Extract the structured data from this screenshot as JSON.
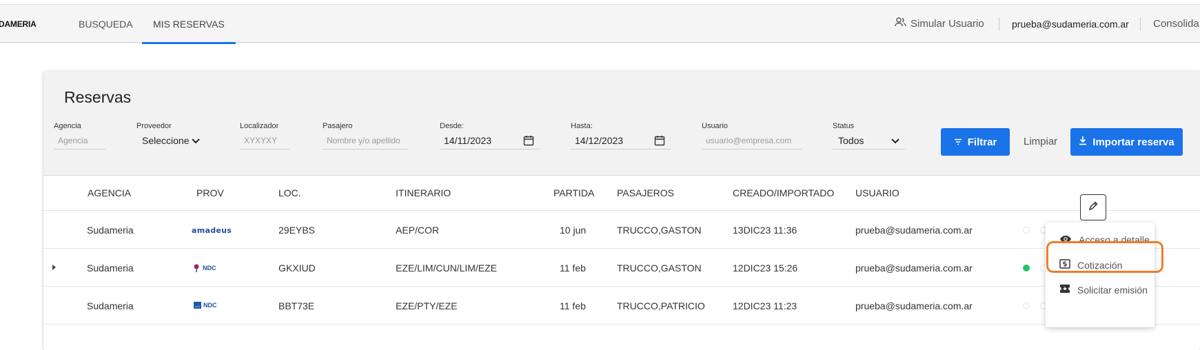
{
  "nav": {
    "brand": "DAMERIA",
    "tabs": [
      {
        "label": "BUSQUEDA"
      },
      {
        "label": "MIS RESERVAS"
      }
    ],
    "simulate_user": "Simular Usuario",
    "email": "prueba@sudameria.com.ar",
    "consolidate": "Consolida"
  },
  "page": {
    "title": "Reservas"
  },
  "filters": {
    "agencia": {
      "label": "Agencia",
      "placeholder": "Agencia"
    },
    "proveedor": {
      "label": "Proveedor",
      "value": "Seleccione"
    },
    "localizador": {
      "label": "Localizador",
      "placeholder": "XYXYXY"
    },
    "pasajero": {
      "label": "Pasajero",
      "placeholder": "Nombre y/o apellido"
    },
    "desde": {
      "label": "Desde:",
      "value": "14/11/2023"
    },
    "hasta": {
      "label": "Hasta:",
      "value": "14/12/2023"
    },
    "usuario": {
      "label": "Usuario",
      "placeholder": "usuario@empresa.com"
    },
    "status": {
      "label": "Status",
      "value": "Todos"
    }
  },
  "actions": {
    "filter": "Filtrar",
    "clear": "Limpiar",
    "import": "Importar reserva"
  },
  "table": {
    "headers": [
      "AGENCIA",
      "PROV",
      "LOC.",
      "ITINERARIO",
      "PARTIDA",
      "PASAJEROS",
      "CREADO/IMPORTADO",
      "USUARIO"
    ],
    "rows": [
      {
        "agencia": "Sudameria",
        "prov": "amadeus",
        "loc": "29EYBS",
        "itinerario": "AEP/COR",
        "partida": "10 jun",
        "pasajeros": "TRUCCO,GASTON",
        "creado": "13DIC23 11:36",
        "usuario": "prueba@sudameria.com.ar",
        "expandable": false
      },
      {
        "agencia": "Sudameria",
        "prov": "NDC",
        "loc": "GKXIUD",
        "itinerario": "EZE/LIM/CUN/LIM/EZE",
        "partida": "11 feb",
        "pasajeros": "TRUCCO,GASTON",
        "creado": "12DIC23 15:26",
        "usuario": "prueba@sudameria.com.ar",
        "expandable": true
      },
      {
        "agencia": "Sudameria",
        "prov": "NDC",
        "loc": "BBT73E",
        "itinerario": "EZE/PTY/EZE",
        "partida": "11 feb",
        "pasajeros": "TRUCCO,PATRICIO",
        "creado": "12DIC23 11:23",
        "usuario": "prueba@sudameria.com.ar",
        "expandable": false
      }
    ]
  },
  "menu": {
    "items": [
      {
        "label": "Acceso a detalle",
        "icon": "eye-icon"
      },
      {
        "label": "Cotización",
        "icon": "money-icon"
      },
      {
        "label": "Solicitar emisión",
        "icon": "ticket-icon"
      }
    ]
  },
  "colors": {
    "accent": "#1a73e8",
    "highlight": "#f07c2a",
    "status_green": "#22c55e"
  }
}
